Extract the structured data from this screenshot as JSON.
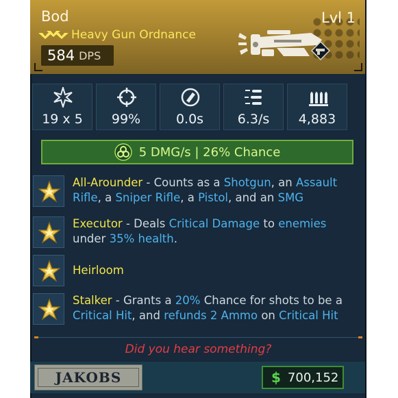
{
  "item": {
    "name": "Bod",
    "level": "Lvl 1",
    "type": "Heavy Gun Ordnance",
    "dps_value": "584",
    "dps_label": "DPS",
    "rarity_icon": "triple-chevron-icon",
    "weapon_icon": "heavy-weapon-silhouette-icon",
    "element_badge_icon": "gun-badge-icon"
  },
  "stats": [
    {
      "icon": "damage-burst-icon",
      "value": "19 x 5"
    },
    {
      "icon": "crosshair-icon",
      "value": "99%"
    },
    {
      "icon": "reload-icon",
      "value": "0.0s"
    },
    {
      "icon": "fire-rate-icon",
      "value": "6.3/s"
    },
    {
      "icon": "ammo-icon",
      "value": "4,883"
    }
  ],
  "element": {
    "icon": "biohazard-icon",
    "text": "5 DMG/s | 26% Chance"
  },
  "perks": [
    {
      "name": "All-Arounder",
      "segments": [
        {
          "t": " - Counts as a ",
          "k": false
        },
        {
          "t": "Shotgun",
          "k": true
        },
        {
          "t": ", an ",
          "k": false
        },
        {
          "t": "Assault Rifle",
          "k": true
        },
        {
          "t": ", a ",
          "k": false
        },
        {
          "t": "Sniper Rifle",
          "k": true
        },
        {
          "t": ", a ",
          "k": false
        },
        {
          "t": "Pistol",
          "k": true
        },
        {
          "t": ", and an ",
          "k": false
        },
        {
          "t": "SMG",
          "k": true
        }
      ]
    },
    {
      "name": "Executor",
      "segments": [
        {
          "t": " - Deals ",
          "k": false
        },
        {
          "t": "Critical Damage",
          "k": true
        },
        {
          "t": " to ",
          "k": false
        },
        {
          "t": "enemies",
          "k": true
        },
        {
          "t": " under ",
          "k": false
        },
        {
          "t": "35% health",
          "k": true
        },
        {
          "t": ".",
          "k": false
        }
      ]
    },
    {
      "name": "Heirloom",
      "segments": []
    },
    {
      "name": "Stalker",
      "segments": [
        {
          "t": " - Grants a ",
          "k": false
        },
        {
          "t": "20%",
          "k": true
        },
        {
          "t": " Chance for shots to be a ",
          "k": false
        },
        {
          "t": "Critical Hit",
          "k": true
        },
        {
          "t": ", and ",
          "k": false
        },
        {
          "t": "refunds 2 Ammo",
          "k": true
        },
        {
          "t": " on ",
          "k": false
        },
        {
          "t": "Critical Hit",
          "k": true
        }
      ]
    }
  ],
  "perk_icon": "gold-star-icon",
  "flavor_text": "Did you hear something?",
  "manufacturer": "JAKOBS",
  "price": {
    "icon": "dollar-icon",
    "value": "700,152"
  },
  "colors": {
    "header_gold": "#c29a38",
    "rarity_yellow": "#fbe75c",
    "keyword_blue": "#4fb2ee",
    "perk_name_yellow": "#f4e44a",
    "flavor_red": "#e63c45",
    "element_green": "#d8f78c",
    "price_green": "#5bd34c"
  }
}
